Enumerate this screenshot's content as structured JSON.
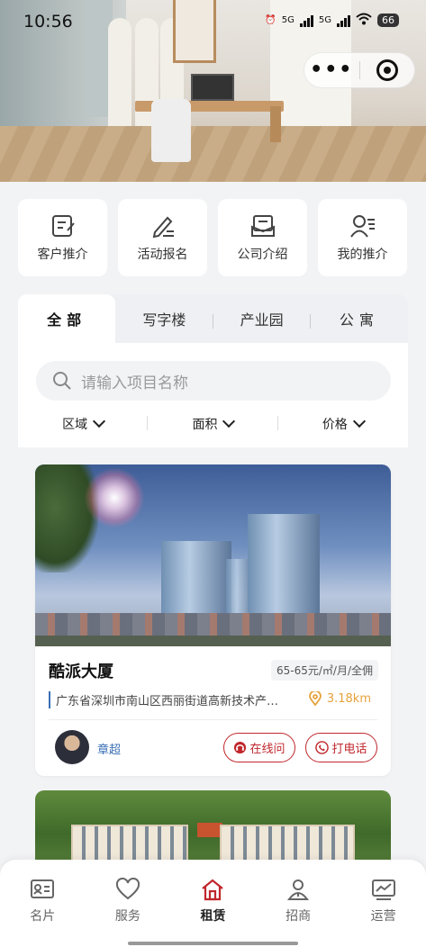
{
  "status_bar": {
    "time": "10:56",
    "signal_1": "5G",
    "signal_2": "5G",
    "battery": "66"
  },
  "quick_actions": [
    {
      "label": "客户推介",
      "icon": "edit-doc-icon"
    },
    {
      "label": "活动报名",
      "icon": "pen-signup-icon"
    },
    {
      "label": "公司介绍",
      "icon": "mail-intro-icon"
    },
    {
      "label": "我的推介",
      "icon": "user-list-icon"
    }
  ],
  "tabs": [
    {
      "label": "全部",
      "active": true
    },
    {
      "label": "写字楼",
      "active": false
    },
    {
      "label": "产业园",
      "active": false
    },
    {
      "label": "公寓",
      "active": false
    }
  ],
  "search": {
    "placeholder": "请输入项目名称"
  },
  "filters": [
    "区域",
    "面积",
    "价格"
  ],
  "listing": {
    "name": "酷派大厦",
    "price": "65-65元/㎡/月/全佣",
    "address": "广东省深圳市南山区西丽街道高新技术产业园",
    "distance": "3.18km",
    "agent": "章超",
    "chat_label": "在线问",
    "call_label": "打电话"
  },
  "tabbar": [
    {
      "label": "名片",
      "icon": "card-icon",
      "active": false
    },
    {
      "label": "服务",
      "icon": "heart-icon",
      "active": false
    },
    {
      "label": "租赁",
      "icon": "home-icon",
      "active": true
    },
    {
      "label": "招商",
      "icon": "person-icon",
      "active": false
    },
    {
      "label": "运营",
      "icon": "chart-icon",
      "active": false
    }
  ],
  "colors": {
    "accent": "#c0272d",
    "link": "#3a6fb5",
    "distance": "#e6a23c"
  }
}
